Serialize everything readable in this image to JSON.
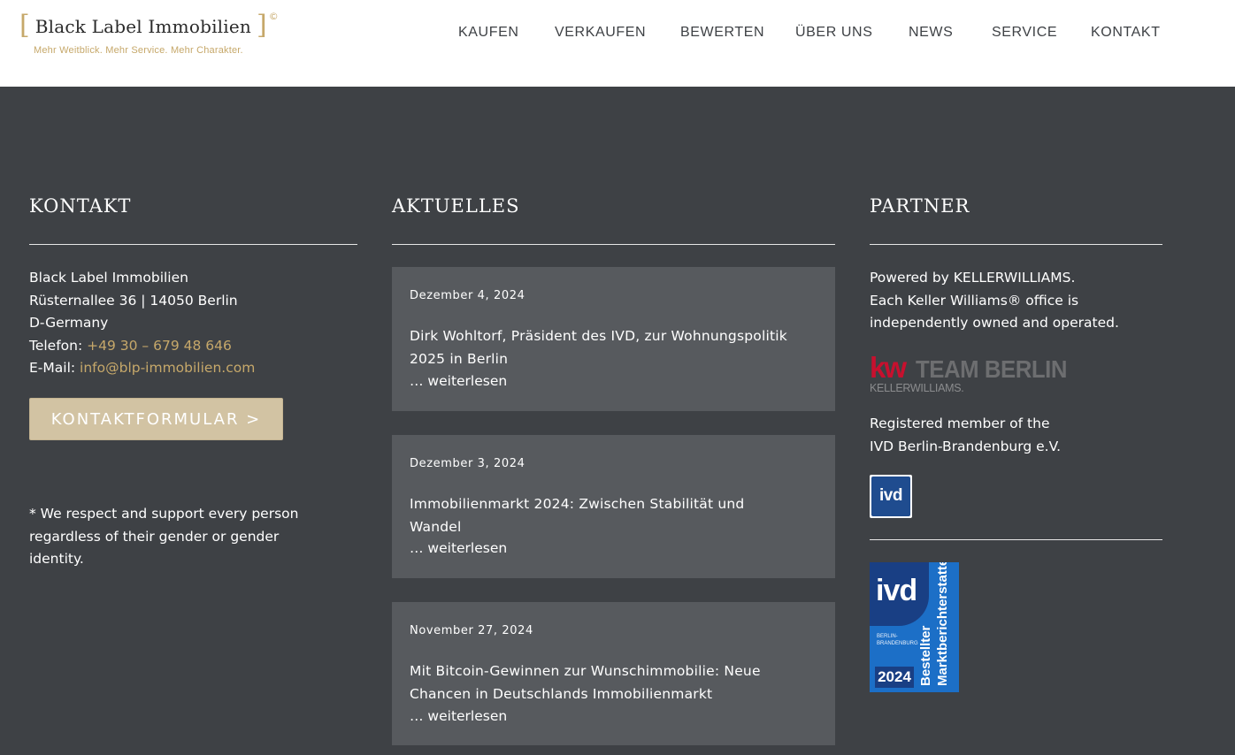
{
  "header": {
    "logo_name": "Black Label Immobilien",
    "logo_bracket_left": "[",
    "logo_bracket_right": "]",
    "logo_copyright": "©",
    "tagline": "Mehr Weitblick. Mehr Service. Mehr Charakter.",
    "nav": [
      "KAUFEN",
      "VERKAUFEN",
      "BEWERTEN",
      "ÜBER UNS",
      "NEWS",
      "SERVICE",
      "KONTAKT"
    ]
  },
  "kontakt": {
    "title": "KONTAKT",
    "company": "Black Label Immobilien",
    "address": "Rüsternallee 36 | 14050 Berlin",
    "country": "D-Germany",
    "phone_label": "Telefon: ",
    "phone": "+49 30 – 679 48 646",
    "email_label": "E-Mail: ",
    "email": "info@blp-immobilien.com",
    "button": "KONTAKTFORMULAR >",
    "note_lines": [
      "* We respect and support every person",
      "regardless of their gender or gender",
      "identity."
    ]
  },
  "aktuelles": {
    "title": "AKTUELLES",
    "posts": [
      {
        "date": "Dezember 4, 2024",
        "title": "Dirk Wohltorf, Präsident des IVD, zur Wohnungspolitik 2025 in Berlin",
        "more": "… weiterlesen"
      },
      {
        "date": "Dezember 3, 2024",
        "title": "Immobilienmarkt 2024: Zwischen Stabilität und Wandel",
        "more": "… weiterlesen"
      },
      {
        "date": "November 27, 2024",
        "title": "Mit Bitcoin-Gewinnen zur Wunschimmobilie: Neue Chancen in Deutschlands Immobilienmarkt",
        "more": "… weiterlesen"
      }
    ]
  },
  "partner": {
    "title": "PARTNER",
    "powered_lines": [
      "Powered by KELLERWILLIAMS.",
      "Each Keller Williams® office is",
      "independently owned and operated."
    ],
    "kw_mark": "kw",
    "kw_team": "TEAM BERLIN",
    "kw_sub": "KELLERWILLIAMS.",
    "registered_lines": [
      "Registered member of the",
      "IVD Berlin-Brandenburg e.V."
    ],
    "ivd_small": "ivd",
    "ivd_big": "ivd",
    "ivd_region": "BERLIN-\nBRANDENBURG",
    "ivd_year": "2024",
    "ivd_vertical": "Bestellter\nMarktberichterstatter"
  },
  "colors": {
    "accent_gold": "#c6a86a",
    "footer_bg": "#3e4145",
    "card_bg": "#575a5e",
    "button_bg": "#d2c3a3",
    "kw_red": "#c8102e",
    "ivd_blue": "#1f4c8f"
  }
}
